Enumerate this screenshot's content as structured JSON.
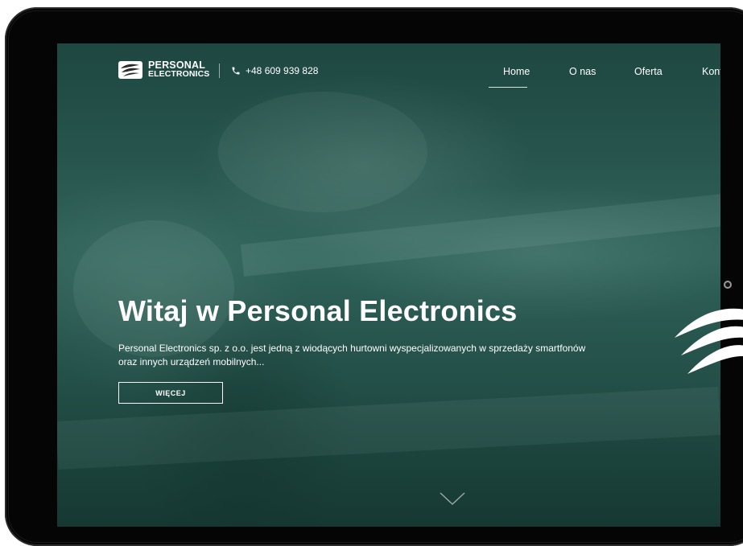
{
  "brand": {
    "line1": "PERSONAL",
    "line2": "ELECTRONICS",
    "accent_color": "#2f6259"
  },
  "header": {
    "phone": "+48 609 939 828",
    "phone_icon": "phone-icon"
  },
  "nav": {
    "items": [
      {
        "label": "Home",
        "active": true
      },
      {
        "label": "O nas",
        "active": false
      },
      {
        "label": "Oferta",
        "active": false
      },
      {
        "label": "Kont",
        "active": false
      }
    ]
  },
  "hero": {
    "title": "Witaj w Personal Electronics",
    "description": "Personal Electronics sp. z o.o. jest jedną z wiodących hurtowni wyspecjalizowanych w sprzedaży smartfonów oraz innych urządzeń mobilnych...",
    "button_label": "WIĘCEJ",
    "scroll_icon": "chevron-down-icon"
  }
}
